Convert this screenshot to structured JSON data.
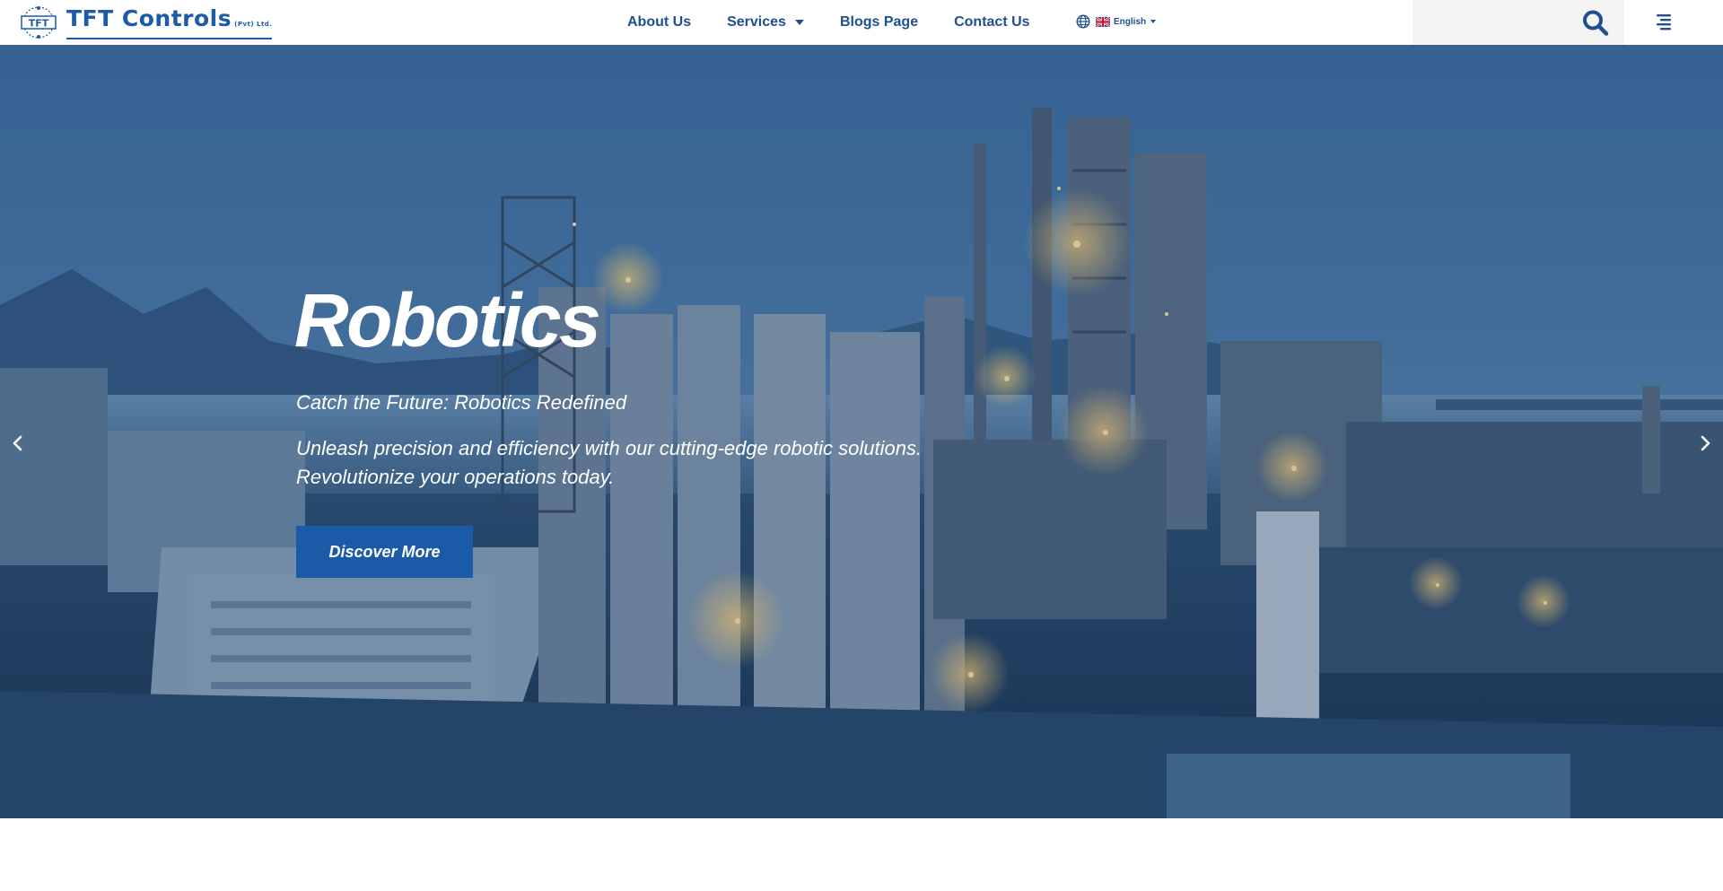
{
  "brand": {
    "logo_mark": "TFT",
    "name": "TFT Controls",
    "suffix": "(Pvt) Ltd.",
    "color": "#1b5ba8"
  },
  "nav": {
    "items": [
      {
        "label": "About Us"
      },
      {
        "label": "Services",
        "has_dropdown": true
      },
      {
        "label": "Blogs Page"
      },
      {
        "label": "Contact Us"
      }
    ],
    "color": "#1e4f8f"
  },
  "language": {
    "selected": "English",
    "icon": "globe-icon",
    "flag_icon": "uk-flag-icon"
  },
  "search": {
    "value": "",
    "placeholder": "",
    "icon": "search-icon"
  },
  "menu": {
    "icon": "hamburger-menu-icon"
  },
  "hero": {
    "title": "Robotics",
    "tagline": "Catch the Future: Robotics Redefined",
    "description": "Unleash precision and efficiency with our cutting-edge robotic solutions. Revolutionize your operations today.",
    "cta_label": "Discover More",
    "cta_color": "#1b5aa6",
    "prev_icon": "chevron-left-icon",
    "next_icon": "chevron-right-icon"
  }
}
